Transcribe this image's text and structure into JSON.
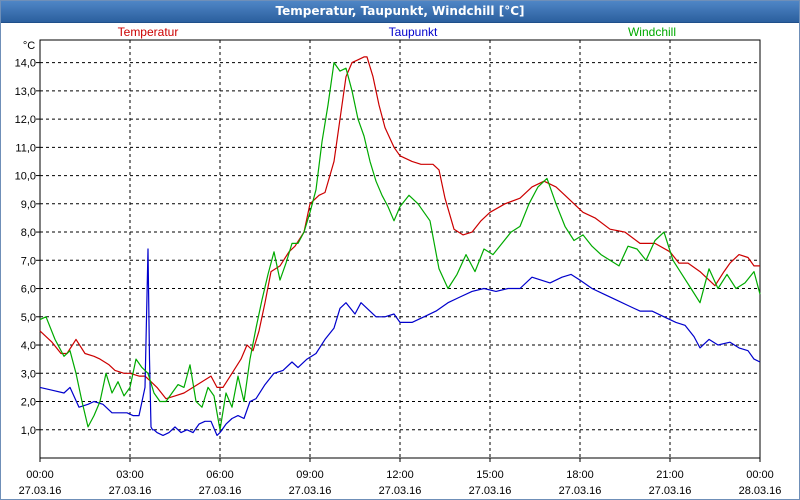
{
  "window": {
    "title": "Temperatur, Taupunkt, Windchill [°C]"
  },
  "chart_data": {
    "type": "line",
    "title": "Temperatur, Taupunkt, Windchill [°C]",
    "ylabel": "°C",
    "xlabel": "",
    "ylim": [
      0.0,
      14.8
    ],
    "xlim_hours": [
      0,
      24
    ],
    "y_ticks": [
      "1,0",
      "2,0",
      "3,0",
      "4,0",
      "5,0",
      "6,0",
      "7,0",
      "8,0",
      "9,0",
      "10,0",
      "11,0",
      "12,0",
      "13,0",
      "14,0"
    ],
    "x_ticks": [
      {
        "time": "00:00",
        "date": "27.03.16"
      },
      {
        "time": "03:00",
        "date": "27.03.16"
      },
      {
        "time": "06:00",
        "date": "27.03.16"
      },
      {
        "time": "09:00",
        "date": "27.03.16"
      },
      {
        "time": "12:00",
        "date": "27.03.16"
      },
      {
        "time": "15:00",
        "date": "27.03.16"
      },
      {
        "time": "18:00",
        "date": "27.03.16"
      },
      {
        "time": "21:00",
        "date": "27.03.16"
      },
      {
        "time": "00:00",
        "date": "28.03.16"
      }
    ],
    "grid": true,
    "legend_placement": "top, above plot",
    "series": [
      {
        "name": "Temperatur",
        "color": "#cc0000",
        "x": [
          0,
          0.4,
          0.7,
          0.9,
          1.2,
          1.5,
          1.8,
          2.0,
          2.3,
          2.5,
          2.8,
          3.0,
          3.3,
          3.5,
          3.7,
          3.9,
          4.2,
          4.5,
          4.8,
          5.1,
          5.4,
          5.7,
          5.9,
          6.1,
          6.4,
          6.7,
          6.9,
          7.1,
          7.3,
          7.5,
          7.7,
          8.0,
          8.3,
          8.5,
          8.8,
          9.0,
          9.3,
          9.5,
          9.8,
          10.0,
          10.2,
          10.4,
          10.6,
          10.8,
          10.9,
          11.1,
          11.3,
          11.5,
          11.8,
          12.0,
          12.4,
          12.7,
          13.1,
          13.3,
          13.5,
          13.8,
          14.1,
          14.4,
          14.7,
          15.0,
          15.5,
          16.0,
          16.4,
          16.8,
          17.2,
          17.5,
          17.8,
          18.1,
          18.5,
          19.0,
          19.5,
          20.0,
          20.5,
          21.0,
          21.3,
          21.6,
          22.0,
          22.3,
          22.5,
          22.8,
          23.0,
          23.3,
          23.6,
          23.8,
          24.0
        ],
        "values": [
          4.5,
          4.1,
          3.7,
          3.7,
          4.2,
          3.7,
          3.6,
          3.5,
          3.3,
          3.1,
          3.0,
          3.0,
          2.9,
          2.9,
          2.7,
          2.5,
          2.1,
          2.2,
          2.3,
          2.5,
          2.7,
          2.9,
          2.5,
          2.5,
          3.0,
          3.5,
          4.0,
          3.8,
          4.5,
          5.5,
          6.6,
          6.8,
          7.3,
          7.5,
          8.0,
          9.0,
          9.3,
          9.4,
          10.5,
          12.0,
          13.5,
          14.0,
          14.1,
          14.2,
          14.2,
          13.5,
          12.5,
          11.7,
          11.0,
          10.7,
          10.5,
          10.4,
          10.4,
          10.2,
          9.2,
          8.1,
          7.9,
          8.0,
          8.4,
          8.7,
          9.0,
          9.2,
          9.6,
          9.8,
          9.6,
          9.3,
          9.0,
          8.7,
          8.5,
          8.1,
          8.0,
          7.6,
          7.6,
          7.3,
          6.9,
          6.9,
          6.6,
          6.3,
          6.1,
          6.6,
          6.9,
          7.2,
          7.1,
          6.8,
          6.8
        ]
      },
      {
        "name": "Taupunkt",
        "color": "#0000cc",
        "x": [
          0,
          0.4,
          0.8,
          1.0,
          1.3,
          1.6,
          1.8,
          2.1,
          2.4,
          2.6,
          2.9,
          3.1,
          3.3,
          3.5,
          3.6,
          3.65,
          3.7,
          3.75,
          3.8,
          3.9,
          4.1,
          4.3,
          4.5,
          4.7,
          4.9,
          5.1,
          5.3,
          5.5,
          5.7,
          5.9,
          6.0,
          6.2,
          6.4,
          6.6,
          6.8,
          7.0,
          7.2,
          7.5,
          7.8,
          8.1,
          8.4,
          8.6,
          8.9,
          9.2,
          9.5,
          9.8,
          10.0,
          10.2,
          10.5,
          10.7,
          10.9,
          11.2,
          11.5,
          11.8,
          12.0,
          12.4,
          12.8,
          13.2,
          13.6,
          14.0,
          14.4,
          14.8,
          15.2,
          15.6,
          16.0,
          16.4,
          16.7,
          17.0,
          17.4,
          17.7,
          18.0,
          18.4,
          18.8,
          19.2,
          19.6,
          20.0,
          20.4,
          20.8,
          21.2,
          21.5,
          21.8,
          22.0,
          22.3,
          22.6,
          23.0,
          23.3,
          23.6,
          23.8,
          24.0
        ],
        "values": [
          2.5,
          2.4,
          2.3,
          2.5,
          1.8,
          1.9,
          2.0,
          1.9,
          1.6,
          1.6,
          1.6,
          1.5,
          1.5,
          2.5,
          7.4,
          3.5,
          1.1,
          1.0,
          1.0,
          0.9,
          0.8,
          0.9,
          1.1,
          0.9,
          1.0,
          0.9,
          1.2,
          1.3,
          1.3,
          0.8,
          0.9,
          1.2,
          1.4,
          1.5,
          1.4,
          2.0,
          2.1,
          2.6,
          3.0,
          3.1,
          3.4,
          3.2,
          3.5,
          3.7,
          4.2,
          4.6,
          5.3,
          5.5,
          5.1,
          5.5,
          5.3,
          5.0,
          5.0,
          5.1,
          4.8,
          4.8,
          5.0,
          5.2,
          5.5,
          5.7,
          5.9,
          6.0,
          5.9,
          6.0,
          6.0,
          6.4,
          6.3,
          6.2,
          6.4,
          6.5,
          6.3,
          6.0,
          5.8,
          5.6,
          5.4,
          5.2,
          5.2,
          5.0,
          4.8,
          4.7,
          4.3,
          3.9,
          4.2,
          4.0,
          4.1,
          3.9,
          3.8,
          3.5,
          3.4
        ]
      },
      {
        "name": "Windchill",
        "color": "#00aa00",
        "x": [
          0,
          0.2,
          0.5,
          0.8,
          1.0,
          1.2,
          1.4,
          1.6,
          1.8,
          2.0,
          2.2,
          2.4,
          2.6,
          2.8,
          3.0,
          3.2,
          3.4,
          3.6,
          3.8,
          4.0,
          4.2,
          4.4,
          4.6,
          4.8,
          5.0,
          5.2,
          5.4,
          5.6,
          5.8,
          6.0,
          6.2,
          6.4,
          6.6,
          6.8,
          7.0,
          7.2,
          7.4,
          7.6,
          7.8,
          8.0,
          8.2,
          8.4,
          8.6,
          8.8,
          9.0,
          9.2,
          9.4,
          9.6,
          9.8,
          10.0,
          10.2,
          10.4,
          10.6,
          10.8,
          11.0,
          11.2,
          11.4,
          11.6,
          11.8,
          12.0,
          12.3,
          12.6,
          13.0,
          13.3,
          13.6,
          13.9,
          14.2,
          14.5,
          14.8,
          15.1,
          15.4,
          15.7,
          16.0,
          16.3,
          16.6,
          16.9,
          17.2,
          17.5,
          17.8,
          18.1,
          18.4,
          18.7,
          19.0,
          19.3,
          19.6,
          19.9,
          20.2,
          20.5,
          20.8,
          21.1,
          21.4,
          21.7,
          22.0,
          22.3,
          22.6,
          22.9,
          23.2,
          23.5,
          23.8,
          24.0
        ],
        "values": [
          4.9,
          5.0,
          4.2,
          3.6,
          3.8,
          3.0,
          2.0,
          1.1,
          1.5,
          2.0,
          3.0,
          2.3,
          2.7,
          2.2,
          2.5,
          3.5,
          3.2,
          3.0,
          2.3,
          2.0,
          2.0,
          2.3,
          2.6,
          2.5,
          3.3,
          2.0,
          1.8,
          2.5,
          2.2,
          1.0,
          2.3,
          1.8,
          2.9,
          2.0,
          3.5,
          4.6,
          5.6,
          6.5,
          7.3,
          6.3,
          6.9,
          7.6,
          7.6,
          8.0,
          8.7,
          9.5,
          11.2,
          12.5,
          14.0,
          13.7,
          13.8,
          13.0,
          12.0,
          11.4,
          10.5,
          9.8,
          9.3,
          8.9,
          8.4,
          8.9,
          9.3,
          9.0,
          8.4,
          6.7,
          6.0,
          6.5,
          7.2,
          6.6,
          7.4,
          7.2,
          7.6,
          8.0,
          8.2,
          9.0,
          9.6,
          9.9,
          9.0,
          8.2,
          7.7,
          7.9,
          7.5,
          7.2,
          7.0,
          6.8,
          7.5,
          7.4,
          7.0,
          7.7,
          8.0,
          7.0,
          6.5,
          6.0,
          5.5,
          6.7,
          6.0,
          6.5,
          6.0,
          6.2,
          6.6,
          5.8
        ]
      }
    ]
  }
}
